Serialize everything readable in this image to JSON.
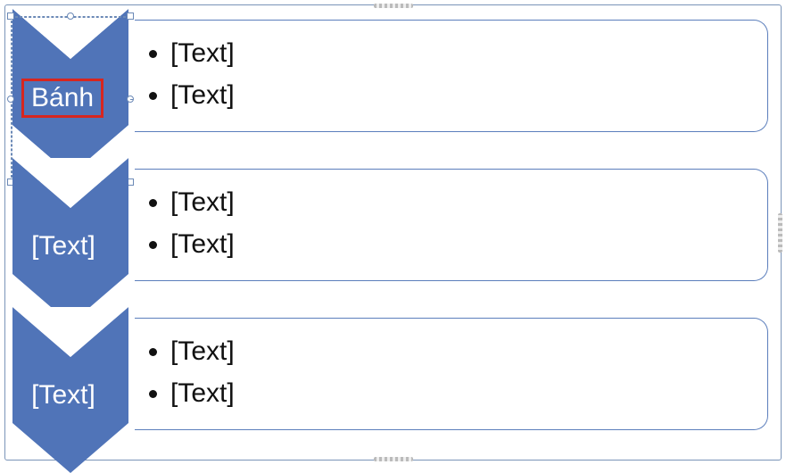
{
  "smartart": {
    "type": "vertical-chevron-list",
    "accent_color": "#5074b8",
    "border_color": "#5b7ebc",
    "selection_color": "#d7261f",
    "steps": [
      {
        "label": "Bánh",
        "editing": true,
        "bullets": [
          "[Text]",
          "[Text]"
        ]
      },
      {
        "label": "[Text]",
        "editing": false,
        "bullets": [
          "[Text]",
          "[Text]"
        ]
      },
      {
        "label": "[Text]",
        "editing": false,
        "bullets": [
          "[Text]",
          "[Text]"
        ]
      }
    ]
  }
}
